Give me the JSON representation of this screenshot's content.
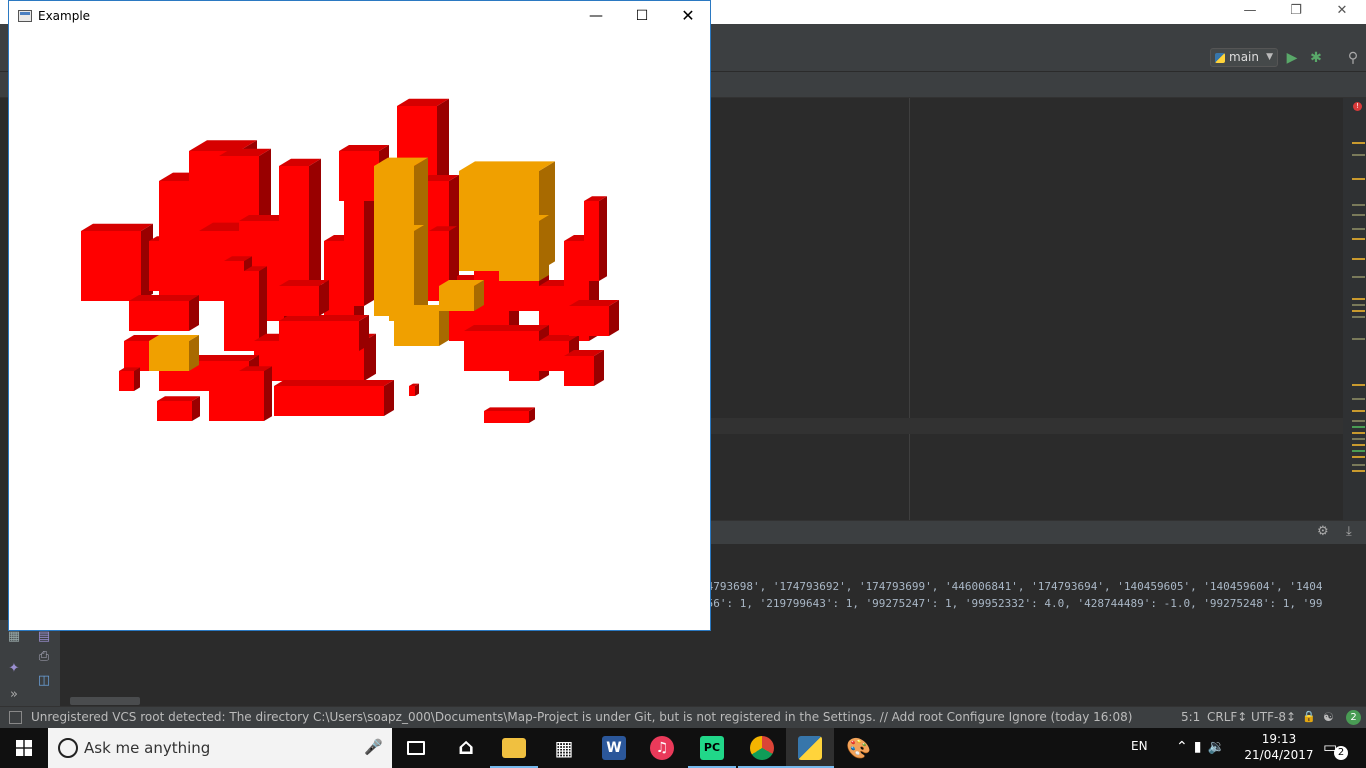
{
  "ide": {
    "run_config": "main",
    "status_message": "Unregistered VCS root detected: The directory C:\\Users\\soapz_000\\Documents\\Map-Project is under Git, but is not registered in the Settings. // Add root  Configure  Ignore (today 16:08)",
    "caret_position": "5:1",
    "line_separator": "CRLF↕",
    "encoding": "UTF-8↕",
    "notification_count": "2",
    "console_lines": [
      "74793698', '174793692', '174793699', '446006841', '174793694', '140459605', '140459604', '1404",
      "956': 1, '219799643': 1, '99275247': 1, '99952332': 4.0, '428744489': -1.0, '99275248': 1, '99"
    ]
  },
  "example_window": {
    "title": "Example",
    "colors": {
      "building_red": "#ff0000",
      "building_red_shadow": "#990000",
      "building_red_mid": "#d60000",
      "building_highlight": "#f0a000",
      "building_highlight_shadow": "#a86a00"
    }
  },
  "taskbar": {
    "search_placeholder": "Ask me anything",
    "apps": [
      "task-view",
      "home",
      "file-explorer",
      "store",
      "word",
      "itunes",
      "pycharm",
      "chrome",
      "python",
      "paint"
    ],
    "language": "EN",
    "time": "19:13",
    "date": "21/04/2017",
    "notifications": "2"
  }
}
